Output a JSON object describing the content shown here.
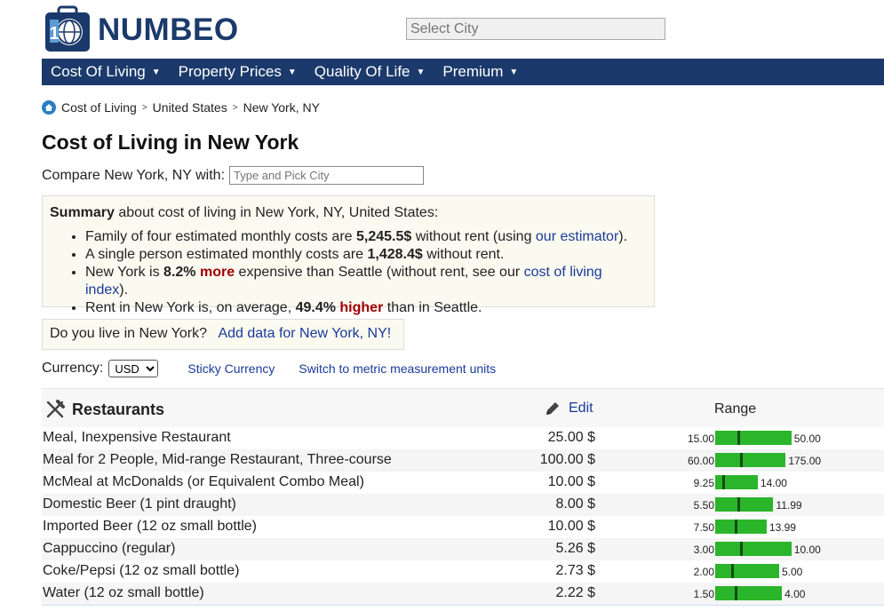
{
  "brand": {
    "name": "NUMBEO"
  },
  "header": {
    "select_city_placeholder": "Select City"
  },
  "nav": [
    {
      "label": "Cost Of Living"
    },
    {
      "label": "Property Prices"
    },
    {
      "label": "Quality Of Life"
    },
    {
      "label": "Premium"
    }
  ],
  "breadcrumb": [
    "Cost of Living",
    "United States",
    "New York, NY"
  ],
  "title": "Cost of Living in New York",
  "compare": {
    "label": "Compare New York, NY with:",
    "placeholder": "Type and Pick City"
  },
  "summary": {
    "lead_bold": "Summary",
    "lead_rest": " about cost of living in New York, NY, United States:",
    "items": [
      {
        "a": "Family of four estimated monthly costs are ",
        "b": "5,245.5$",
        "c": " without rent (using ",
        "link": "our estimator",
        "d": ")."
      },
      {
        "a": "A single person estimated monthly costs are ",
        "b": "1,428.4$",
        "c": " without rent."
      },
      {
        "a": "New York is ",
        "b": "8.2%",
        "red": "more",
        "c": " expensive than Seattle (without rent, see our ",
        "link": "cost of living index",
        "d": ")."
      },
      {
        "a": "Rent in New York is, on average, ",
        "b": "49.4%",
        "red": "higher",
        "c": " than in Seattle."
      }
    ]
  },
  "live": {
    "question": "Do you live in New York?",
    "link": "Add data for New York, NY!"
  },
  "currency": {
    "label": "Currency:",
    "selected": "USD",
    "sticky": "Sticky Currency",
    "metric": "Switch to metric measurement units"
  },
  "restaurants": {
    "title": "Restaurants",
    "edit": "Edit",
    "range_header": "Range",
    "bar_color": "#2ab52a",
    "rows": [
      {
        "name": "Meal, Inexpensive Restaurant",
        "price": "25.00 $",
        "lo": "15.00",
        "hi": "50.00",
        "bar_start": 15,
        "bar_end": 50,
        "value": 25
      },
      {
        "name": "Meal for 2 People, Mid-range Restaurant, Three-course",
        "price": "100.00 $",
        "lo": "60.00",
        "hi": "175.00",
        "bar_start": 60,
        "bar_end": 175,
        "value": 100
      },
      {
        "name": "McMeal at McDonalds (or Equivalent Combo Meal)",
        "price": "10.00 $",
        "lo": "9.25",
        "hi": "14.00",
        "bar_start": 9.25,
        "bar_end": 14,
        "value": 10
      },
      {
        "name": "Domestic Beer (1 pint draught)",
        "price": "8.00 $",
        "lo": "5.50",
        "hi": "11.99",
        "bar_start": 5.5,
        "bar_end": 11.99,
        "value": 8
      },
      {
        "name": "Imported Beer (12 oz small bottle)",
        "price": "10.00 $",
        "lo": "7.50",
        "hi": "13.99",
        "bar_start": 7.5,
        "bar_end": 13.99,
        "value": 10
      },
      {
        "name": "Cappuccino (regular)",
        "price": "5.26 $",
        "lo": "3.00",
        "hi": "10.00",
        "bar_start": 3,
        "bar_end": 10,
        "value": 5.26
      },
      {
        "name": "Coke/Pepsi (12 oz small bottle)",
        "price": "2.73 $",
        "lo": "2.00",
        "hi": "5.00",
        "bar_start": 2,
        "bar_end": 5,
        "value": 2.73
      },
      {
        "name": "Water (12 oz small bottle)",
        "price": "2.22 $",
        "lo": "1.50",
        "hi": "4.00",
        "bar_start": 1.5,
        "bar_end": 4,
        "value": 2.22
      }
    ]
  }
}
